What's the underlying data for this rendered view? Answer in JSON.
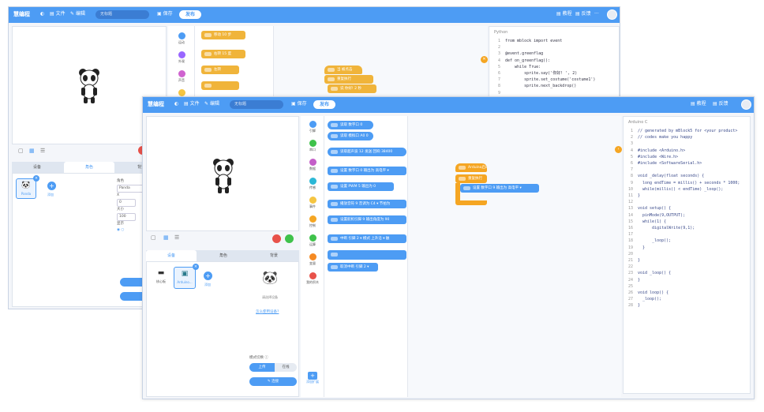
{
  "back": {
    "brand": "慧编程",
    "menu_file": "文件",
    "menu_edit": "编辑",
    "title_value": "无标题",
    "save": "保存",
    "publish": "发布",
    "tutorial": "教程",
    "feedback": "反馈",
    "more": "···",
    "tabs": [
      "设备",
      "角色",
      "背景"
    ],
    "sprite_name": "Panda",
    "add_label": "添加",
    "props": [
      "角色",
      "Panda",
      "X",
      "0",
      "大小",
      "100",
      "显示"
    ],
    "categories": [
      "运动",
      "外观",
      "声音"
    ],
    "blocks": [
      "移动 10 步",
      "右转 15 度",
      "左转",
      "",
      "面向方向"
    ],
    "script_blocks": [
      "当 被点击",
      "重复执行",
      "说 你好! 2 秒"
    ],
    "code_lang": "Python",
    "code_lines": [
      "from mblock import event",
      "",
      "@event.greenflag",
      "def on_greenflag():",
      "    while True:",
      "        sprite.say('你好! ', 2)",
      "        sprite.set_costume('costume1')",
      "        sprite.next_backdrop()",
      ""
    ],
    "line_numbers": [
      "1",
      "2",
      "3",
      "4",
      "5",
      "6",
      "7",
      "8",
      "9"
    ]
  },
  "front": {
    "brand": "慧编程",
    "menu_file": "文件",
    "menu_edit": "编辑",
    "title_value": "无标题",
    "save": "保存",
    "publish": "发布",
    "tutorial": "教程",
    "feedback": "反馈",
    "tabs": [
      "设备",
      "角色",
      "背景"
    ],
    "devices": [
      {
        "label": "核心板"
      },
      {
        "label": "Arduino..."
      }
    ],
    "add_label": "添加",
    "sprite_hint": "请选择设备",
    "how_to_link": "怎么使用设备?",
    "mode_label": "模式切换 ⓘ",
    "mode_upload": "上传",
    "mode_live": "在线",
    "connect_label": "连接",
    "categories": [
      "引脚",
      "串口",
      "数据",
      "传感",
      "事件",
      "控制",
      "运算",
      "变量",
      "我的积木"
    ],
    "extension_label": "添加扩展",
    "blocks": [
      "读取 数字口 0",
      "读取 模拟口 A0 0",
      "读取超声波 12 发送 回响 38400",
      "设置 数字口 0 输出为 高电平 ▾",
      "设置 PWM 5 输出为 0",
      "播放音符 9 音调为 C4 ▾ 节拍为",
      "设置舵机引脚 9 输出角度为 90",
      "中断 引脚 2 ▾ 模式 上升沿 ▾ 触",
      "",
      "取消中断 引脚 2 ▾"
    ],
    "script_hat": "Arduino启动",
    "script_blocks": [
      "重复执行",
      "设置 数字口 9 输出为 高电平 ▾"
    ],
    "code_lang": "Arduino C",
    "code_lines": [
      "// generated by mBlock5 for <your product>",
      "// codes make you happy",
      "",
      "#include <Arduino.h>",
      "#include <Wire.h>",
      "#include <SoftwareSerial.h>",
      "",
      "void _delay(float seconds) {",
      "  long endTime = millis() + seconds * 1000;",
      "  while(millis() < endTime) _loop();",
      "}",
      "",
      "void setup() {",
      "  pinMode(9,OUTPUT);",
      "  while(1) {",
      "      digitalWrite(9,1);",
      "",
      "      _loop();",
      "  }",
      "",
      "}",
      "",
      "void _loop() {",
      "}",
      "",
      "void loop() {",
      "  _loop();",
      "}"
    ],
    "line_numbers": [
      "1",
      "2",
      "3",
      "4",
      "5",
      "6",
      "7",
      "8",
      "9",
      "10",
      "11",
      "12",
      "13",
      "14",
      "15",
      "16",
      "17",
      "18",
      "19",
      "20",
      "21",
      "22",
      "23",
      "24",
      "25",
      "26",
      "27",
      "28"
    ]
  },
  "colors": {
    "titlebar": "#4d9cf4",
    "accent": "#4d9cf4",
    "orange": "#f5a623",
    "green": "#3fc24b",
    "red": "#e8524a"
  }
}
